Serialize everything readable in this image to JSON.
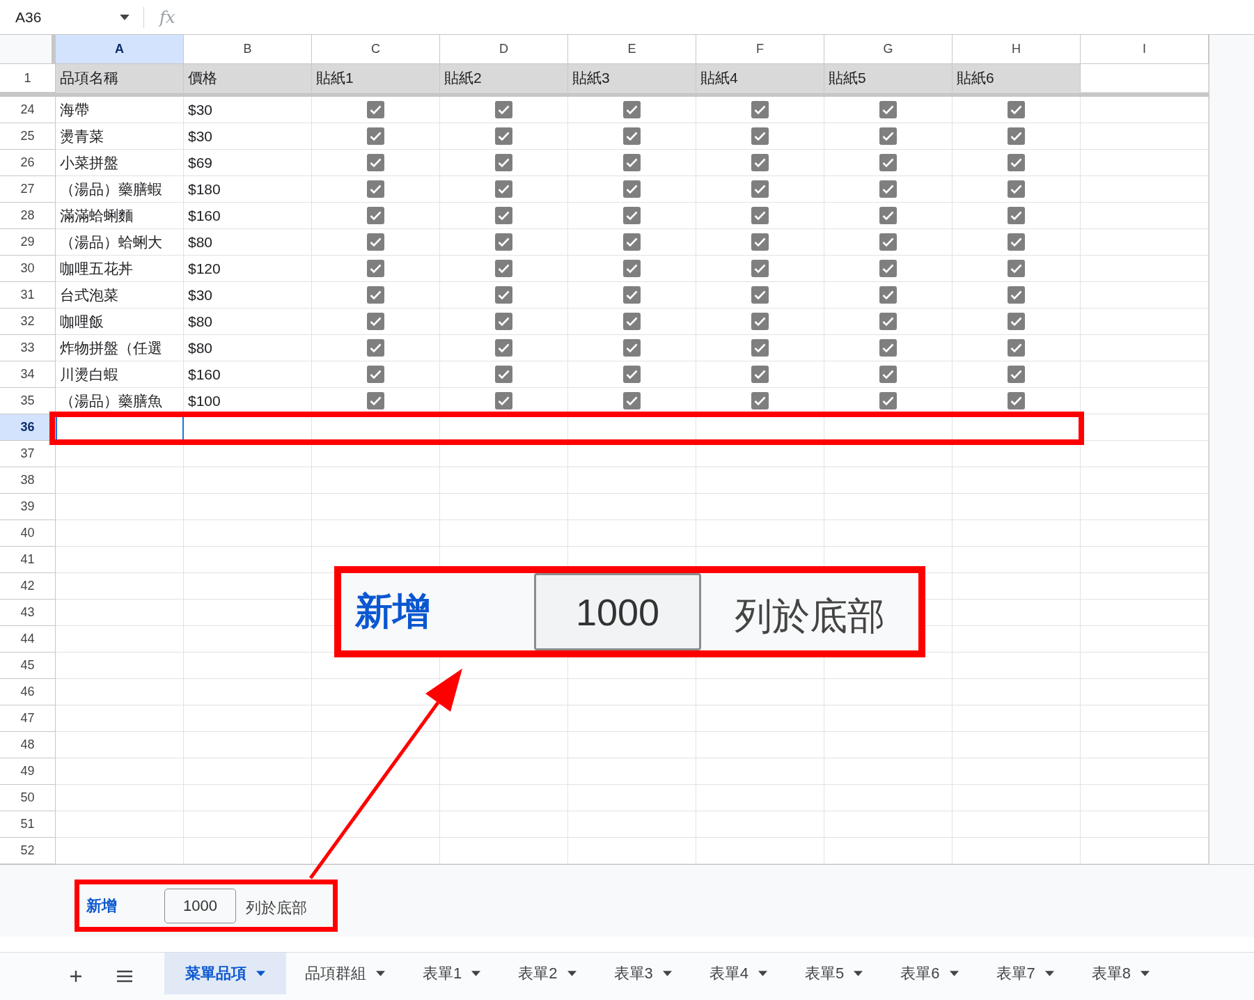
{
  "name_box": "A36",
  "formula_label": "fx",
  "columns": [
    {
      "label": "A",
      "selected": true
    },
    {
      "label": "B",
      "selected": false
    },
    {
      "label": "C",
      "selected": false
    },
    {
      "label": "D",
      "selected": false
    },
    {
      "label": "E",
      "selected": false
    },
    {
      "label": "F",
      "selected": false
    },
    {
      "label": "G",
      "selected": false
    },
    {
      "label": "H",
      "selected": false
    },
    {
      "label": "I",
      "selected": false
    }
  ],
  "header_row": {
    "number": "1",
    "cells": [
      "品項名稱",
      "價格",
      "貼紙1",
      "貼紙2",
      "貼紙3",
      "貼紙4",
      "貼紙5",
      "貼紙6"
    ]
  },
  "rows": [
    {
      "number": "24",
      "selected": false,
      "name": "海帶",
      "price": "$30",
      "stickers": [
        true,
        true,
        true,
        true,
        true,
        true
      ]
    },
    {
      "number": "25",
      "selected": false,
      "name": "燙青菜",
      "price": "$30",
      "stickers": [
        true,
        true,
        true,
        true,
        true,
        true
      ]
    },
    {
      "number": "26",
      "selected": false,
      "name": "小菜拼盤",
      "price": "$69",
      "stickers": [
        true,
        true,
        true,
        true,
        true,
        true
      ]
    },
    {
      "number": "27",
      "selected": false,
      "name": "（湯品）藥膳蝦",
      "price": "$180",
      "stickers": [
        true,
        true,
        true,
        true,
        true,
        true
      ]
    },
    {
      "number": "28",
      "selected": false,
      "name": "滿滿蛤蜊麵",
      "price": "$160",
      "stickers": [
        true,
        true,
        true,
        true,
        true,
        true
      ]
    },
    {
      "number": "29",
      "selected": false,
      "name": "（湯品）蛤蜊大",
      "price": "$80",
      "stickers": [
        true,
        true,
        true,
        true,
        true,
        true
      ]
    },
    {
      "number": "30",
      "selected": false,
      "name": "咖哩五花丼",
      "price": "$120",
      "stickers": [
        true,
        true,
        true,
        true,
        true,
        true
      ]
    },
    {
      "number": "31",
      "selected": false,
      "name": "台式泡菜",
      "price": "$30",
      "stickers": [
        true,
        true,
        true,
        true,
        true,
        true
      ]
    },
    {
      "number": "32",
      "selected": false,
      "name": "咖哩飯",
      "price": "$80",
      "stickers": [
        true,
        true,
        true,
        true,
        true,
        true
      ]
    },
    {
      "number": "33",
      "selected": false,
      "name": "炸物拼盤（任選",
      "price": "$80",
      "stickers": [
        true,
        true,
        true,
        true,
        true,
        true
      ]
    },
    {
      "number": "34",
      "selected": false,
      "name": "川燙白蝦",
      "price": "$160",
      "stickers": [
        true,
        true,
        true,
        true,
        true,
        true
      ]
    },
    {
      "number": "35",
      "selected": false,
      "name": "（湯品）藥膳魚",
      "price": "$100",
      "stickers": [
        true,
        true,
        true,
        true,
        true,
        true
      ]
    },
    {
      "number": "36",
      "selected": true
    },
    {
      "number": "37",
      "selected": false
    },
    {
      "number": "38",
      "selected": false
    },
    {
      "number": "39",
      "selected": false
    },
    {
      "number": "40",
      "selected": false
    },
    {
      "number": "41",
      "selected": false
    },
    {
      "number": "42",
      "selected": false
    },
    {
      "number": "43",
      "selected": false
    },
    {
      "number": "44",
      "selected": false
    },
    {
      "number": "45",
      "selected": false
    },
    {
      "number": "46",
      "selected": false
    },
    {
      "number": "47",
      "selected": false
    },
    {
      "number": "48",
      "selected": false
    },
    {
      "number": "49",
      "selected": false
    },
    {
      "number": "50",
      "selected": false
    },
    {
      "number": "51",
      "selected": false
    },
    {
      "number": "52",
      "selected": false
    }
  ],
  "add_rows_bar": {
    "link": "新增",
    "count": "1000",
    "suffix": "列於底部"
  },
  "callout": {
    "link": "新增",
    "count": "1000",
    "suffix": "列於底部"
  },
  "sheet_tabs": [
    {
      "label": "菜單品項",
      "selected": true
    },
    {
      "label": "品項群組",
      "selected": false
    },
    {
      "label": "表單1",
      "selected": false
    },
    {
      "label": "表單2",
      "selected": false
    },
    {
      "label": "表單3",
      "selected": false
    },
    {
      "label": "表單4",
      "selected": false
    },
    {
      "label": "表單5",
      "selected": false
    },
    {
      "label": "表單6",
      "selected": false
    },
    {
      "label": "表單7",
      "selected": false
    },
    {
      "label": "表單8",
      "selected": false
    }
  ]
}
